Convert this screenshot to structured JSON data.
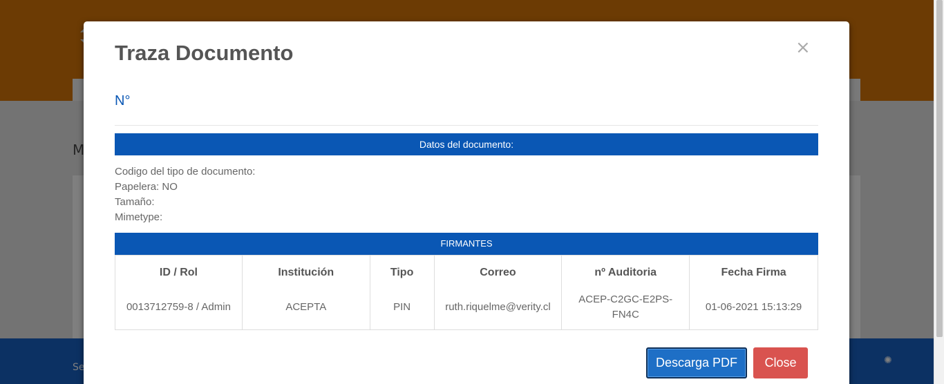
{
  "background": {
    "heading_char": "M",
    "footer_text": "Se"
  },
  "modal": {
    "title": "Traza Documento",
    "close_glyph": "×",
    "doc_number_label": "N°",
    "datos_bar": "Datos del documento:",
    "meta": {
      "codigo": "Codigo del tipo de documento:",
      "papelera": "Papelera: NO",
      "tamano": "Tamaño:",
      "mimetype": "Mimetype:"
    },
    "firmantes_bar": "FIRMANTES",
    "table": {
      "headers": [
        "ID / Rol",
        "Institución",
        "Tipo",
        "Correo",
        "nº Auditoria",
        "Fecha Firma"
      ],
      "rows": [
        [
          "0013712759-8 / Admin",
          "ACEPTA",
          "PIN",
          "ruth.riquelme@verity.cl",
          "ACEP-C2GC-E2PS-FN4C",
          "01-06-2021 15:13:29"
        ]
      ]
    },
    "buttons": {
      "pdf": "Descarga PDF",
      "close": "Close"
    }
  },
  "colors": {
    "header_orange": "#d97708",
    "primary_blue": "#0a57b4",
    "danger_red": "#d9534f",
    "footer_blue": "#1862c6"
  }
}
